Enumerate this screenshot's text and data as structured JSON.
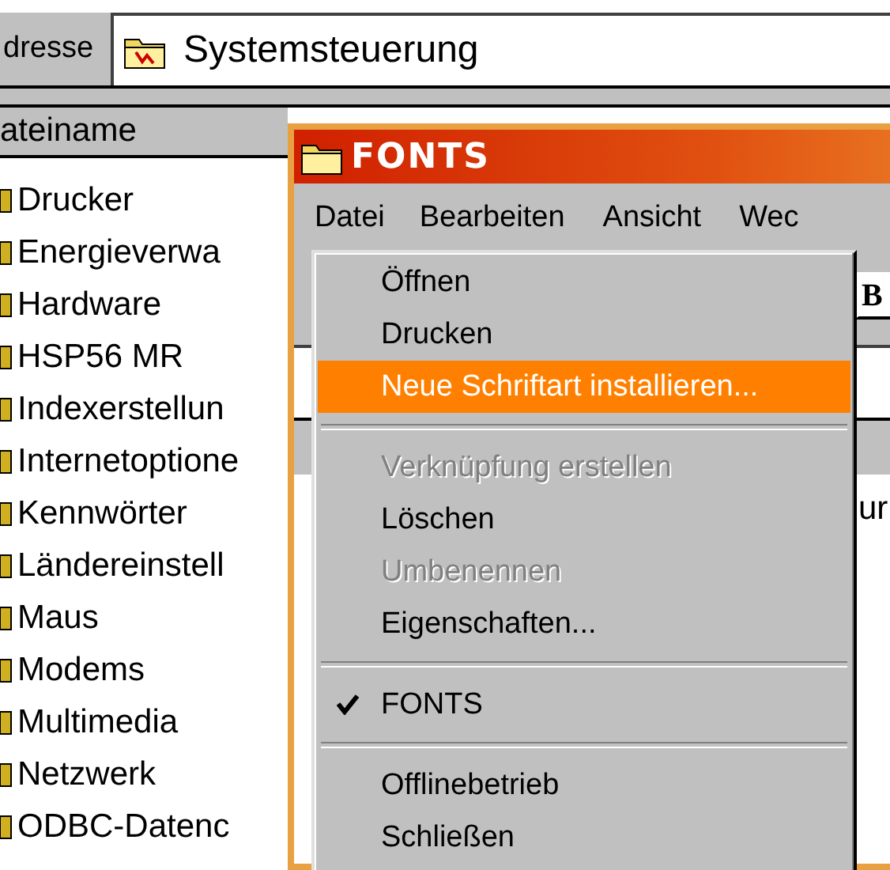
{
  "address_bar": {
    "label": "dresse",
    "value": "Systemsteuerung"
  },
  "file_list": {
    "column_header": "ateiname",
    "items": [
      {
        "name": "Drucker"
      },
      {
        "name": "Energieverwa"
      },
      {
        "name": "Hardware"
      },
      {
        "name": "HSP56 MR"
      },
      {
        "name": "Indexerstellun"
      },
      {
        "name": "Internetoptione"
      },
      {
        "name": "Kennwörter"
      },
      {
        "name": "Ländereinstell"
      },
      {
        "name": "Maus"
      },
      {
        "name": "Modems"
      },
      {
        "name": "Multimedia"
      },
      {
        "name": "Netzwerk"
      },
      {
        "name": "ODBC-Datenc"
      }
    ]
  },
  "window": {
    "title": "FONTS",
    "menu_bar": [
      {
        "label": "Datei",
        "selected": true
      },
      {
        "label": "Bearbeiten",
        "selected": false
      },
      {
        "label": "Ansicht",
        "selected": false
      },
      {
        "label": "Wec",
        "selected": false
      }
    ],
    "toolbar_button": "B",
    "list_text": "ur",
    "menu": [
      {
        "kind": "item",
        "label": "Öffnen",
        "selected": false,
        "disabled": false
      },
      {
        "kind": "item",
        "label": "Drucken",
        "selected": false,
        "disabled": false
      },
      {
        "kind": "item",
        "label": "Neue Schriftart installieren...",
        "selected": true,
        "disabled": false
      },
      {
        "kind": "separator"
      },
      {
        "kind": "item",
        "label": "Verknüpfung erstellen",
        "selected": false,
        "disabled": true
      },
      {
        "kind": "item",
        "label": "Löschen",
        "selected": false,
        "disabled": false
      },
      {
        "kind": "item",
        "label": "Umbenennen",
        "selected": false,
        "disabled": true
      },
      {
        "kind": "item",
        "label": "Eigenschaften...",
        "selected": false,
        "disabled": false
      },
      {
        "kind": "separator"
      },
      {
        "kind": "check",
        "label": "FONTS",
        "checked": true
      },
      {
        "kind": "separator"
      },
      {
        "kind": "item",
        "label": "Offlinebetrieb",
        "selected": false,
        "disabled": false
      },
      {
        "kind": "item",
        "label": "Schließen",
        "selected": false,
        "disabled": false
      }
    ]
  }
}
